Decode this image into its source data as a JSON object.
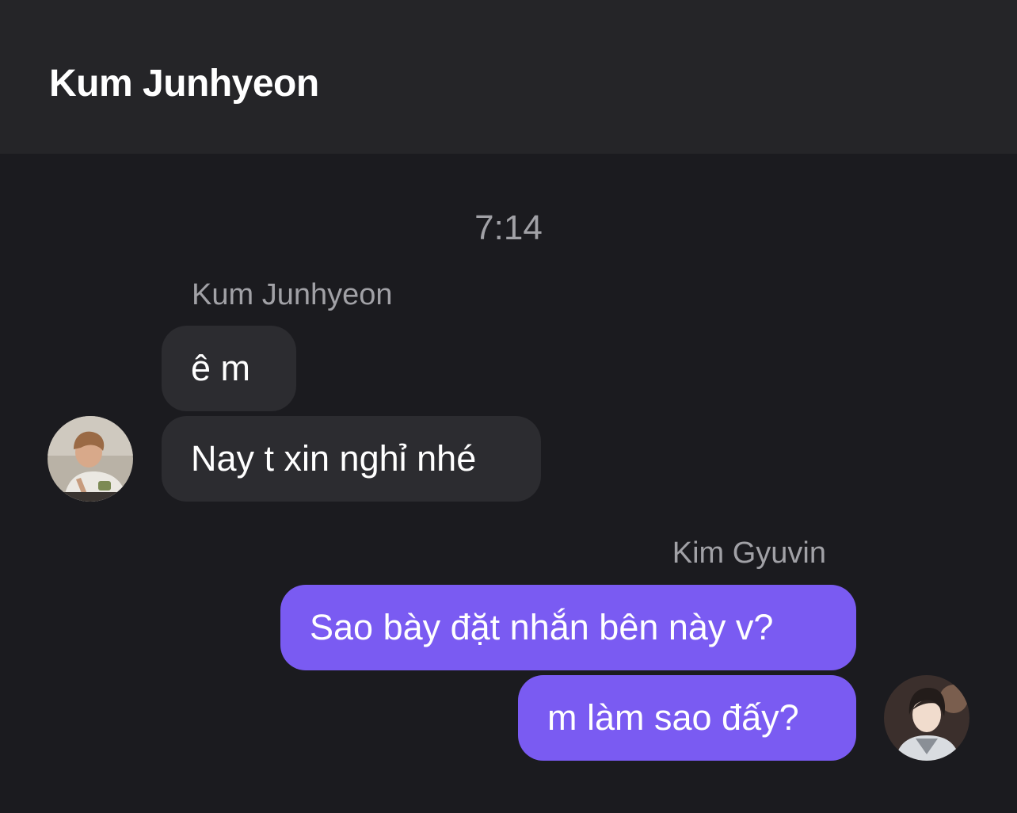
{
  "header": {
    "title": "Kum Junhyeon"
  },
  "chat": {
    "timestamp": "7:14",
    "groups": [
      {
        "sender": "Kum Junhyeon",
        "direction": "incoming",
        "messages": [
          "ê m",
          "Nay t xin nghỉ nhé"
        ]
      },
      {
        "sender": "Kim Gyuvin",
        "direction": "outgoing",
        "messages": [
          "Sao bày đặt nhắn bên này v?",
          "m làm sao đấy?"
        ]
      }
    ]
  },
  "colors": {
    "background": "#1b1b1f",
    "header_background": "#252528",
    "incoming_bubble": "#2c2c30",
    "outgoing_bubble": "#7a5bf2",
    "secondary_text": "#a1a1a6"
  }
}
